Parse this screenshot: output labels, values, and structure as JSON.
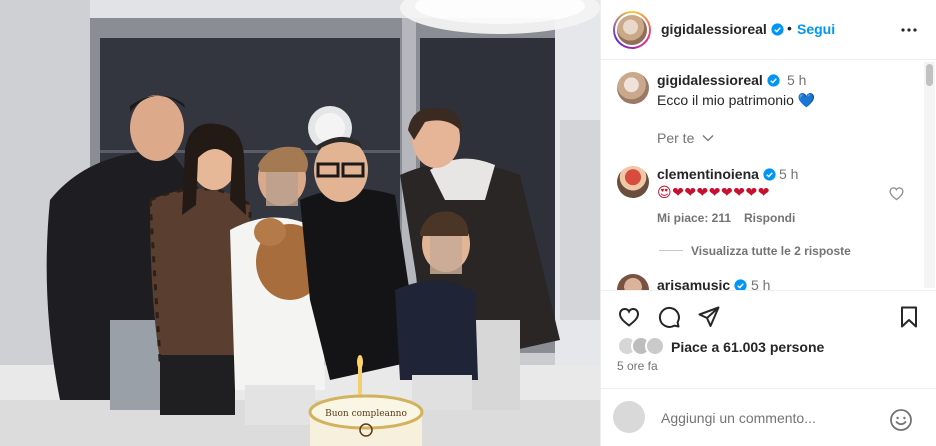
{
  "post": {
    "username": "gigidalessioreal",
    "follow_label": "Segui",
    "separator": "•",
    "more_icon": "more-horizontal-icon"
  },
  "caption": {
    "username": "gigidalessioreal",
    "time": "5 h",
    "text": "Ecco il mio patrimonio",
    "emoji": "💙",
    "translate_label": "Per te"
  },
  "comments": [
    {
      "username": "clementinoiena",
      "time": "5 h",
      "text": "😍❤❤❤❤❤❤❤❤",
      "likes_label": "Mi piace: 211",
      "reply_label": "Rispondi",
      "view_replies": "Visualizza tutte le 2 risposte"
    },
    {
      "username": "arisamusic",
      "time": "5 h"
    }
  ],
  "likes": {
    "text": "Piace a 61.003 persone"
  },
  "timestamp": "5 ore fa",
  "add_comment": {
    "placeholder": "Aggiungi un commento..."
  },
  "photo": {
    "cake_text": "Buon compleanno"
  },
  "colors": {
    "link_blue": "#0095f6",
    "verified_blue": "#0095f6",
    "secondary_text": "#737373"
  }
}
